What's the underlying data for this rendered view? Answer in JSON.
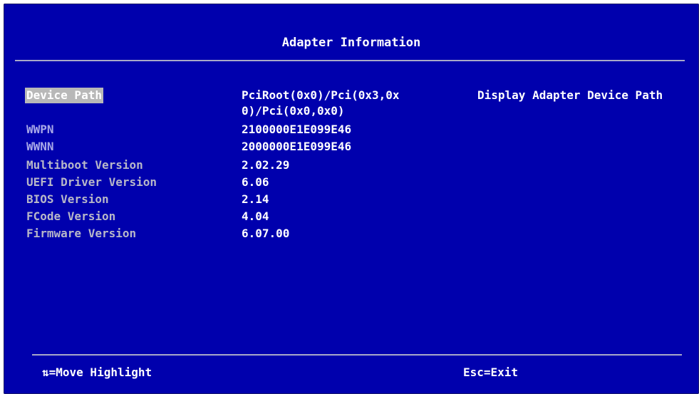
{
  "window": {
    "title": "Adapter Information"
  },
  "fields": [
    {
      "label": "Device Path",
      "value_line1": "PciRoot(0x0)/Pci(0x3,0x",
      "value_line2": "0)/Pci(0x0,0x0)"
    },
    {
      "label": "WWPN",
      "value": "2100000E1E099E46"
    },
    {
      "label": "WWNN",
      "value": "2000000E1E099E46"
    },
    {
      "label": "Multiboot Version",
      "value": "2.02.29"
    },
    {
      "label": "UEFI Driver Version",
      "value": "6.06"
    },
    {
      "label": "BIOS Version",
      "value": "2.14"
    },
    {
      "label": "FCode Version",
      "value": "4.04"
    },
    {
      "label": "Firmware Version",
      "value": "6.07.00"
    }
  ],
  "help": {
    "text": "Display Adapter Device Path"
  },
  "footer": {
    "move_hint": "⇅=Move Highlight",
    "exit_hint": "Esc=Exit"
  },
  "colors": {
    "background": "#0000ad",
    "text": "#ffffff",
    "label": "#b8b8c8",
    "highlight": "#b8b8b8"
  }
}
